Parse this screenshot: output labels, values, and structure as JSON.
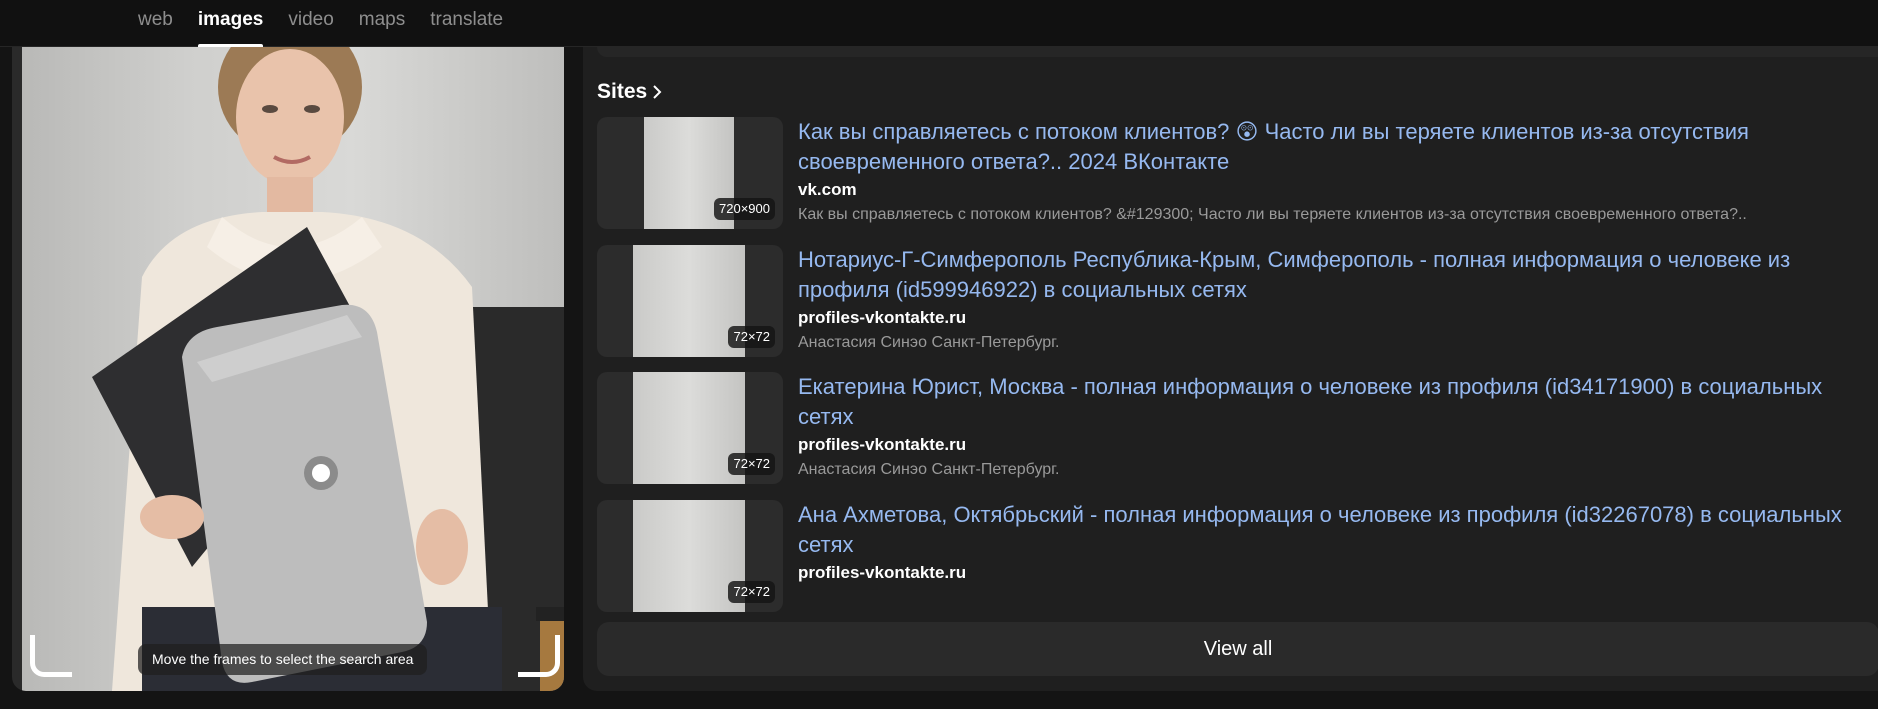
{
  "nav": {
    "tabs": [
      {
        "label": "web"
      },
      {
        "label": "images",
        "active": true
      },
      {
        "label": "video"
      },
      {
        "label": "maps"
      },
      {
        "label": "translate"
      }
    ]
  },
  "preview": {
    "hint": "Move the frames to select the search area"
  },
  "sites": {
    "header": "Sites",
    "items": [
      {
        "title_line1": "Как вы справляетесь с потоком клиентов? 😲 Часто ли вы теряете клиентов из-за отсутствия",
        "title_line2": "своевременного ответа?.. 2024 ВКонтакте",
        "domain": "vk.com",
        "description": "Как вы справляетесь с потоком клиентов? &#129300; Часто ли вы теряете клиентов из-за отсутствия своевременного ответа?..",
        "size": "720×900"
      },
      {
        "title_line1": "Нотариус-Г-Симферополь Республика-Крым, Симферополь - полная информация о человеке из",
        "title_line2": "профиля (id599946922) в социальных сетях",
        "domain": "profiles-vkontakte.ru",
        "description": "Анастасия Синэо Санкт-Петербург.",
        "size": "72×72"
      },
      {
        "title_line1": "Екатерина Юрист, Москва - полная информация о человеке из профиля (id34171900) в социальных",
        "title_line2": "сетях",
        "domain": "profiles-vkontakte.ru",
        "description": "Анастасия Синэо Санкт-Петербург.",
        "size": "72×72"
      },
      {
        "title_line1": "Ана Ахметова, Октябрьский - полная информация о человеке из профиля (id32267078) в социальных",
        "title_line2": "сетях",
        "domain": "profiles-vkontakte.ru",
        "description": "",
        "size": "72×72"
      }
    ],
    "view_all": "View all"
  },
  "colors": {
    "link": "#96b9f0",
    "background": "#141414",
    "panel": "#1f1f1f"
  }
}
